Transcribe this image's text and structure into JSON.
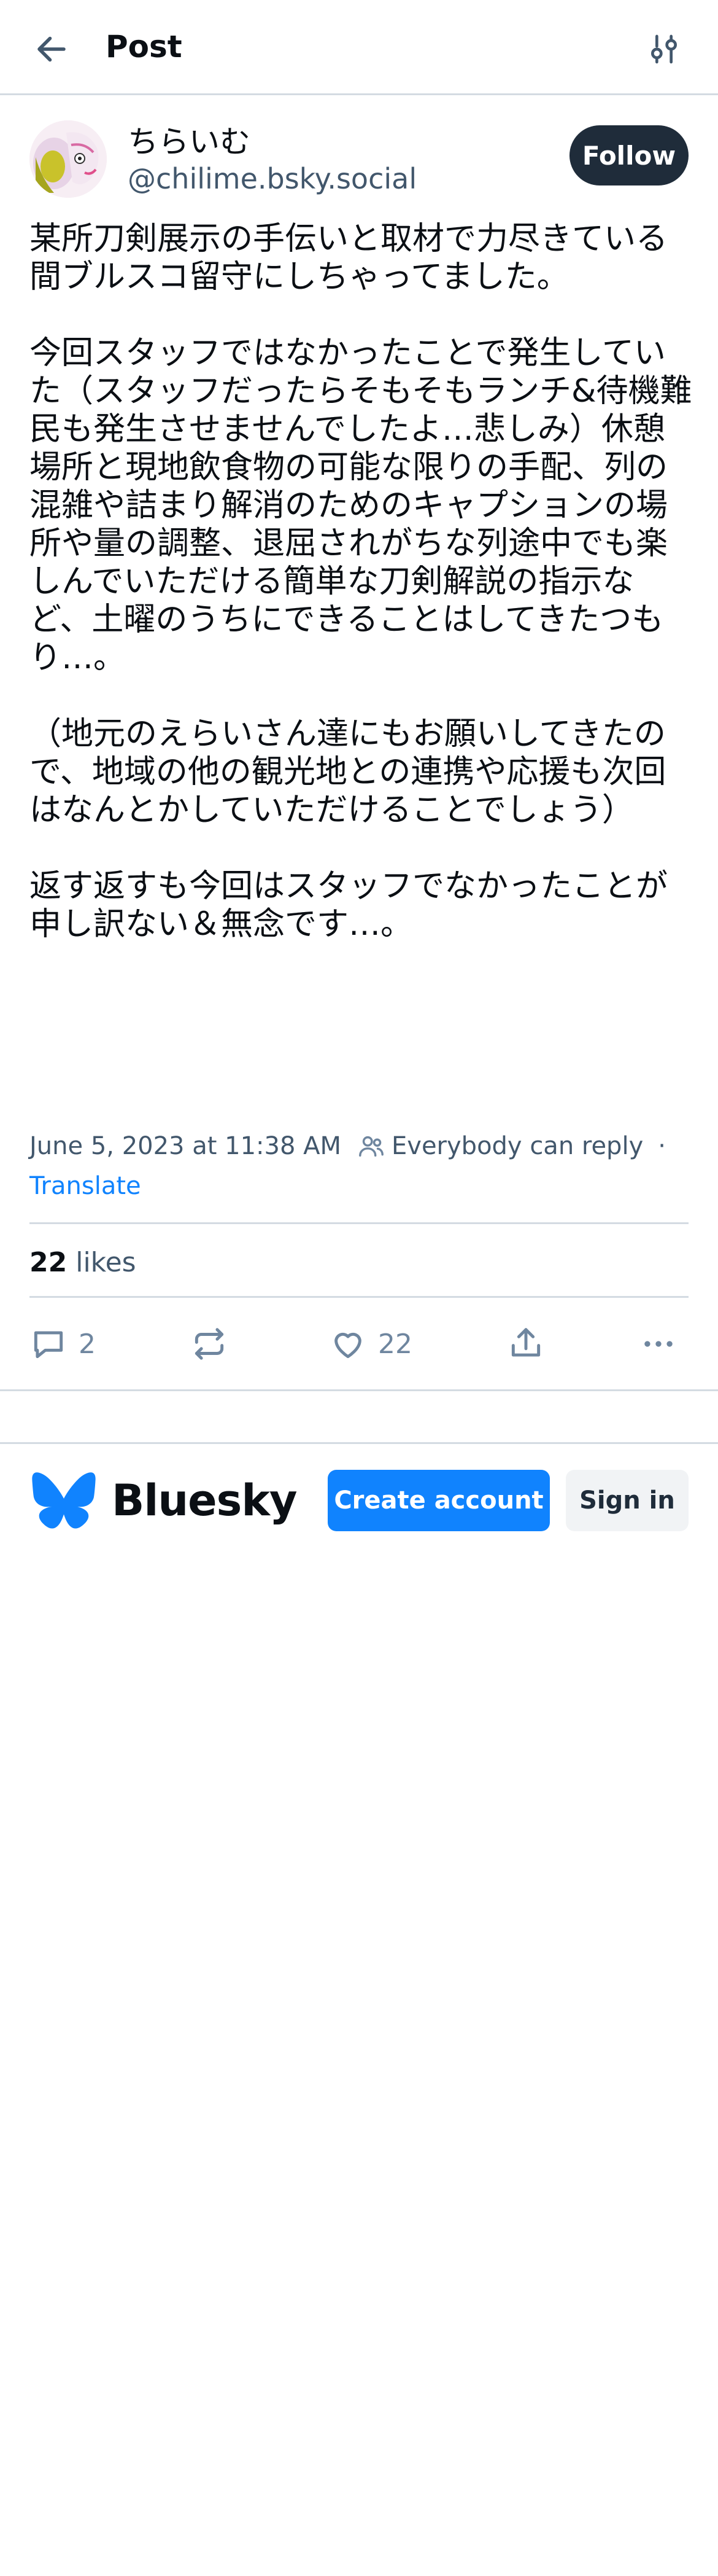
{
  "header": {
    "title": "Post",
    "back_icon": "arrow-left-icon",
    "settings_icon": "sliders-icon"
  },
  "author": {
    "display_name": "ちらいむ",
    "handle": "@chilime.bsky.social",
    "follow_label": "Follow"
  },
  "post": {
    "text": "某所刀剣展示の手伝いと取材で力尽きている間ブルスコ留守にしちゃってました。\n\n今回スタッフではなかったことで発生していた（スタッフだったらそもそもランチ&待機難民も発生させませんでしたよ…悲しみ）休憩場所と現地飲食物の可能な限りの手配、列の混雑や詰まり解消のためのキャプションの場所や量の調整、退屈されがちな列途中でも楽しんでいただける簡単な刀剣解説の指示など、土曜のうちにできることはしてきたつもり…。\n\n（地元のえらいさん達にもお願いしてきたので、地域の他の観光地との連携や応援も次回はなんとかしていただけることでしょう）\n\n返す返すも今回はスタッフでなかったことが申し訳ない＆無念です…。",
    "date": "June 5, 2023 at 11:38 AM",
    "reply_setting": "Everybody can reply",
    "separator": "·",
    "translate_label": "Translate"
  },
  "stats": {
    "likes_count": "22",
    "likes_label": "likes"
  },
  "actions": {
    "reply_count": "2",
    "like_count": "22"
  },
  "footer": {
    "logo_text": "Bluesky",
    "create_account_label": "Create account",
    "sign_in_label": "Sign in"
  },
  "colors": {
    "accent": "#1083fe",
    "dark_button": "#1f2c3a",
    "muted_text": "#42576c",
    "icon_gray": "#6f869f",
    "divider": "#d4dbe2"
  }
}
